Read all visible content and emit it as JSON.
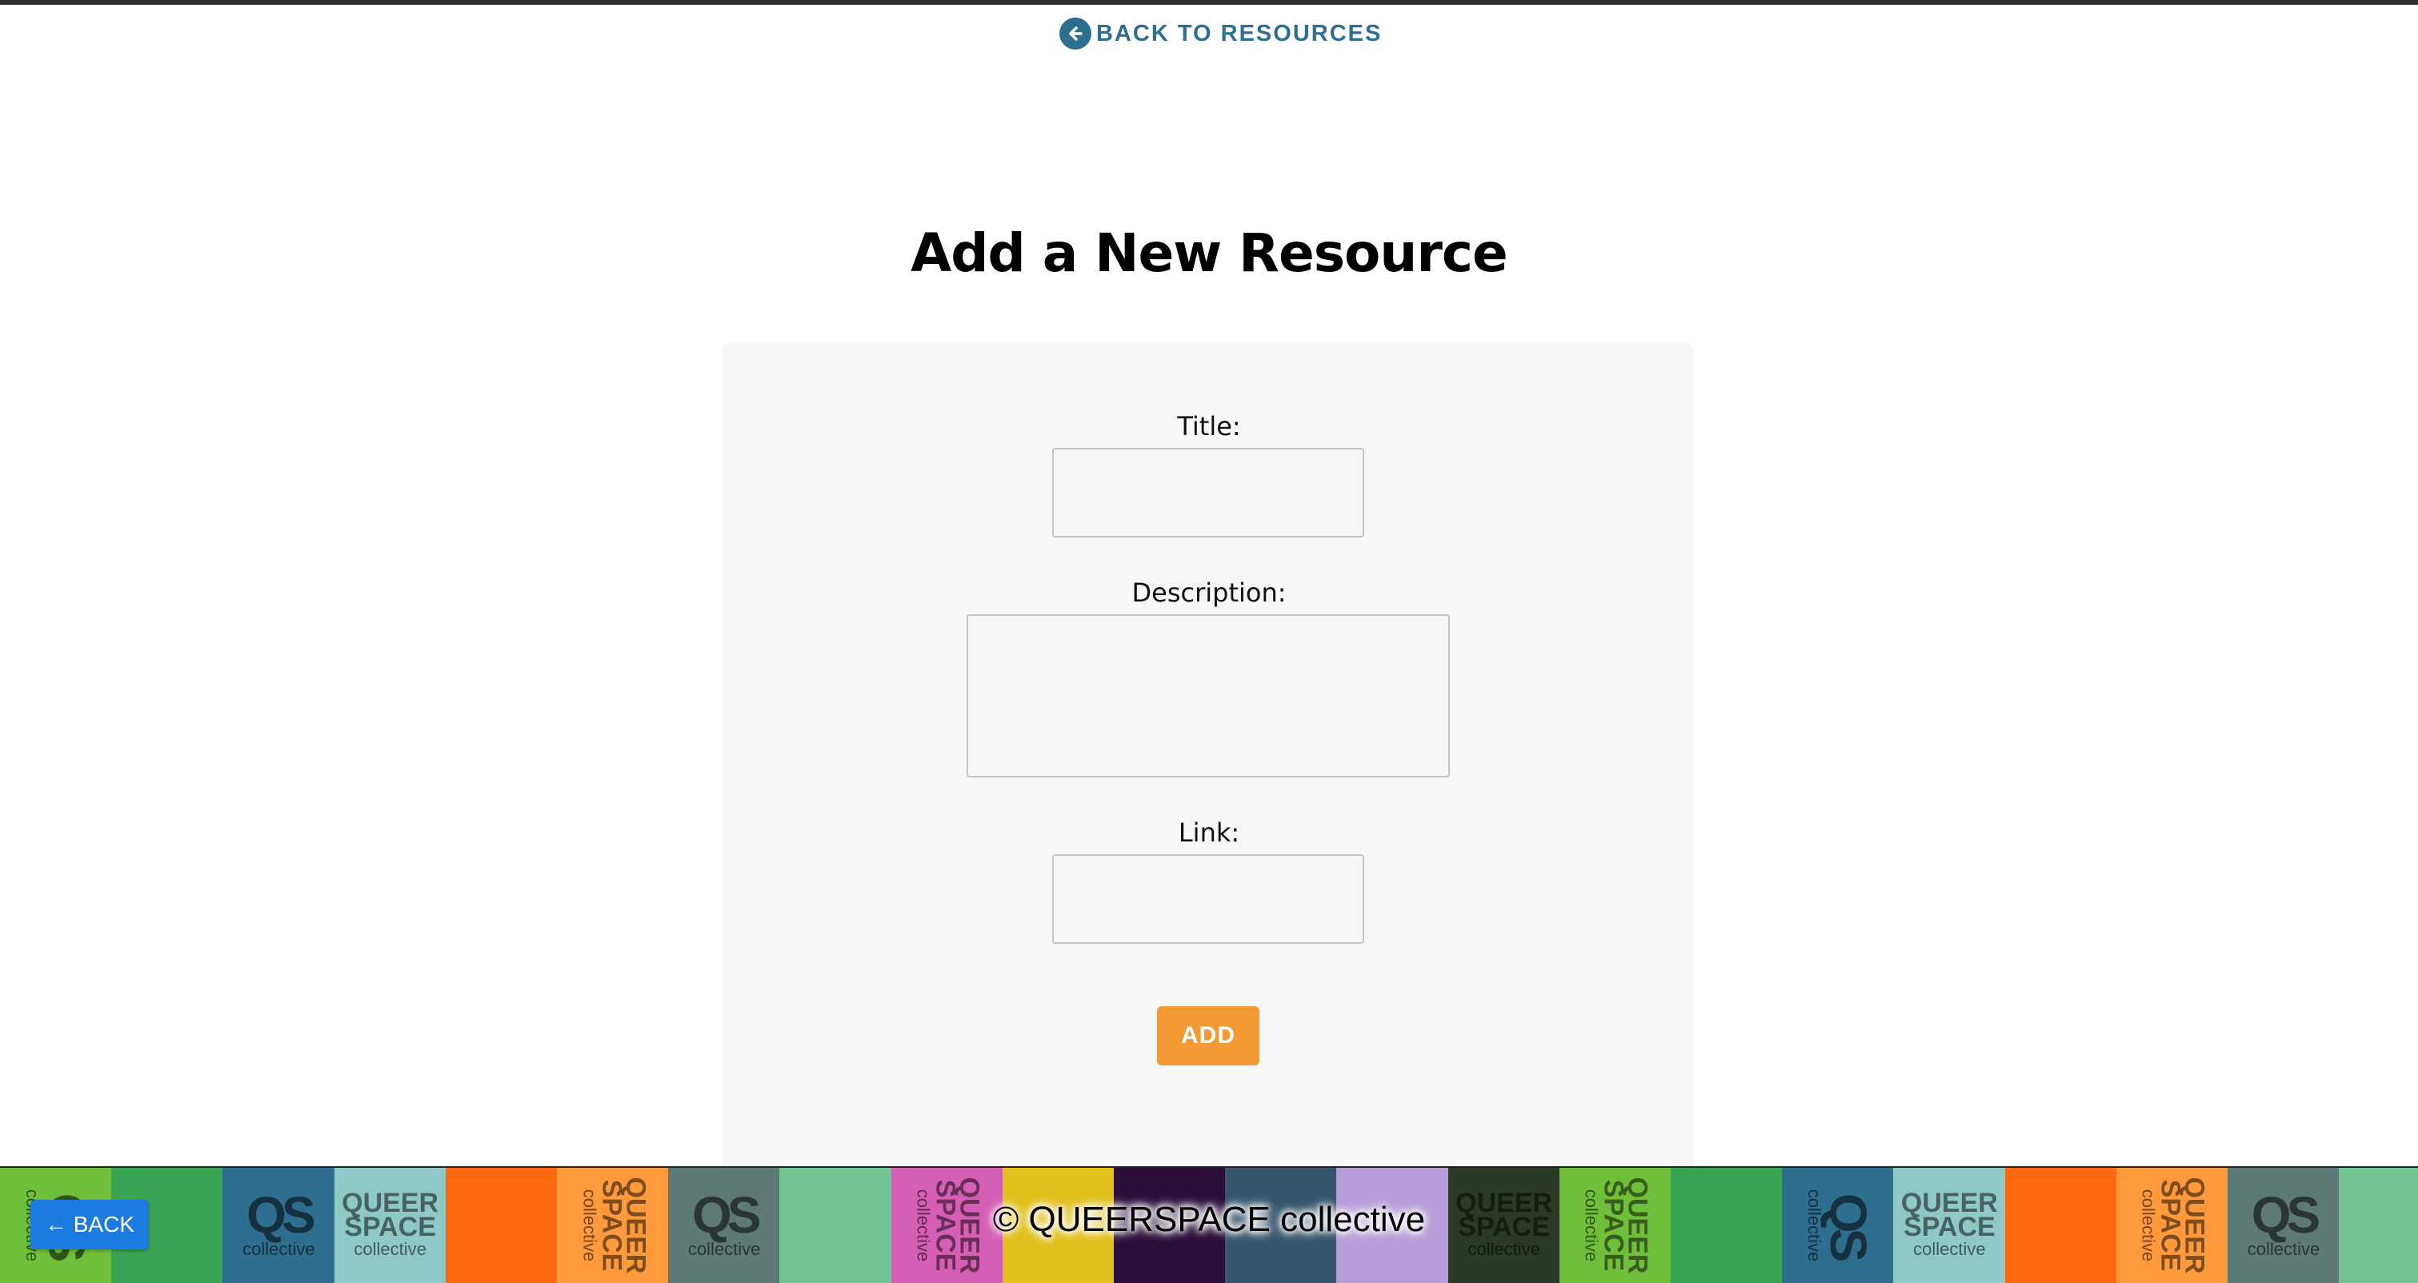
{
  "nav": {
    "back_to_resources": "BACK TO RESOURCES"
  },
  "page": {
    "title": "Add a New Resource"
  },
  "form": {
    "title_label": "Title:",
    "title_value": "",
    "description_label": "Description:",
    "description_value": "",
    "link_label": "Link:",
    "link_value": "",
    "submit_label": "ADD"
  },
  "footer": {
    "copyright": "© QUEERSPACE collective",
    "back_button": "← BACK",
    "tile_colors": [
      "#6fbf3a",
      "#3aa455",
      "#2e6e8e",
      "#8fc9c7",
      "#ff6a10",
      "#ff9a3c",
      "#5e7a76",
      "#72c493",
      "#d55fb4",
      "#e2c11c",
      "#2b0f3a",
      "#34556c",
      "#b89ed8",
      "#2b3a26",
      "#6fbf3a",
      "#3aa455",
      "#2e6e8e",
      "#8fc9c7",
      "#ff6a10",
      "#ff9a3c",
      "#5e7a76",
      "#72c493"
    ],
    "tile_qs": "QS",
    "tile_queer": "QUEER",
    "tile_space": "SPACE",
    "tile_collective": "collective"
  },
  "colors": {
    "accent": "#2e6e8e",
    "submit": "#f39a34",
    "back_button": "#1b7be0",
    "card": "#f7f7f7"
  },
  "icons": {
    "back_to_resources": "arrow-left-circle-icon"
  }
}
